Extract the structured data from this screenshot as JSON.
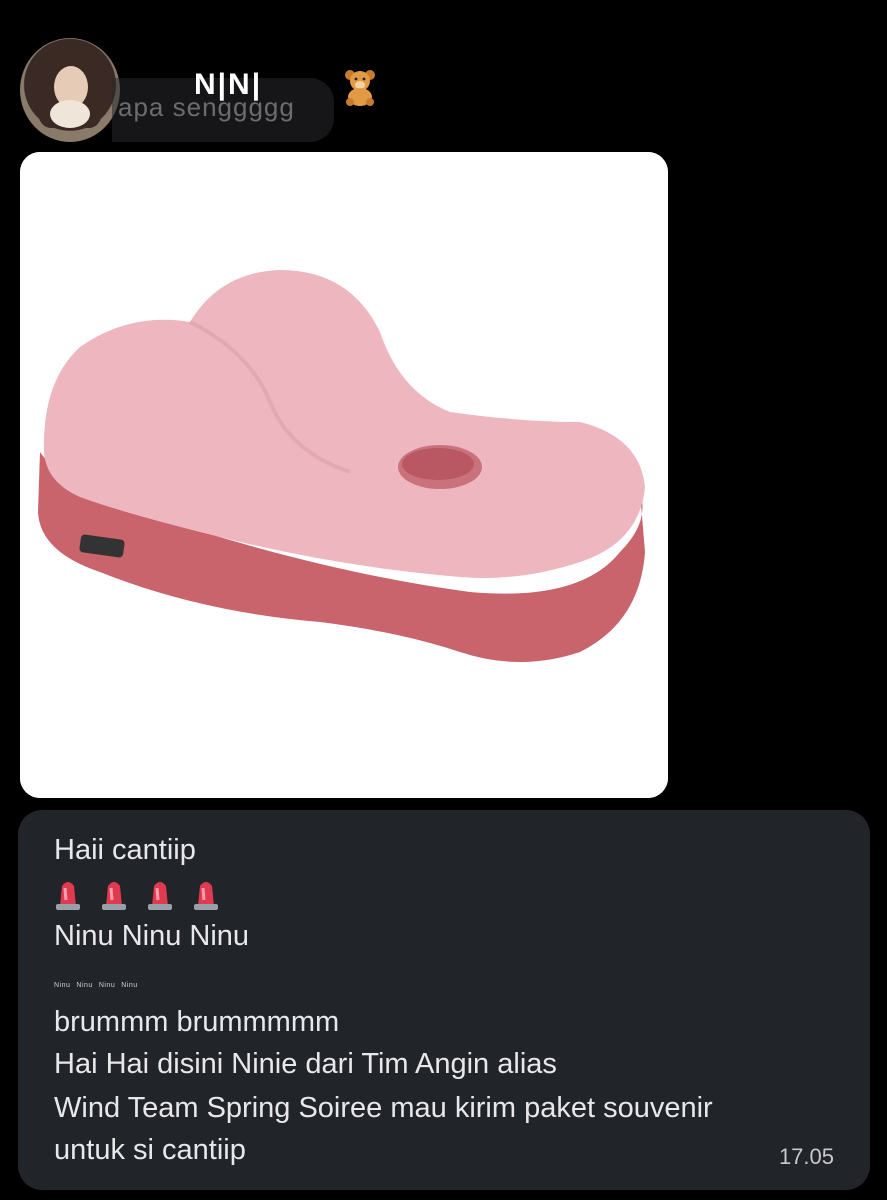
{
  "header": {
    "contact_name": "N|N|",
    "preview_text": "apa senggggg",
    "bear_icon": "teddy-bear-emoji"
  },
  "image_message": {
    "image_description_icon": "pink-cushion-photo"
  },
  "text_message": {
    "greeting": "Haii cantiip",
    "siren_icon": "police-siren-emoji",
    "siren_count": 4,
    "ninu": "Ninu Ninu Ninu",
    "tiny_text": [
      "Ninu",
      "Ninu",
      "Ninu",
      "Ninu"
    ],
    "line1": "brummm brummmmm",
    "line2": "Hai Hai disini Ninie dari Tim Angin alias",
    "line3": "Wind Team Spring Soiree mau kirim paket souvenir",
    "line4": "untuk si cantiip",
    "time": "17.05"
  },
  "colors": {
    "background": "#000000",
    "bubble": "#212429",
    "cushion_top": "#eeb7bf",
    "cushion_base": "#c9636c"
  }
}
